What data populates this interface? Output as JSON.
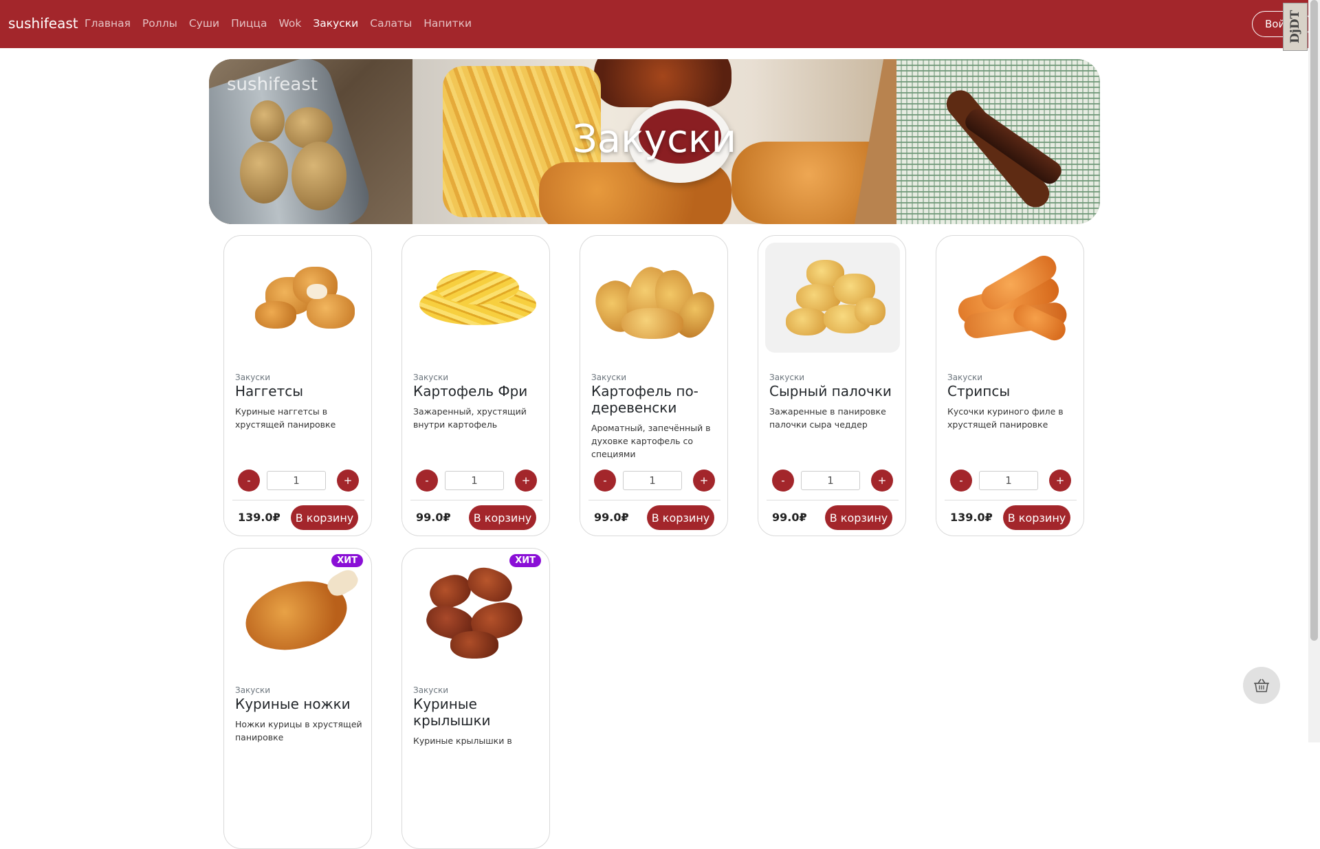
{
  "navbar": {
    "brand": "sushifeast",
    "items": [
      {
        "label": "Главная",
        "active": false
      },
      {
        "label": "Роллы",
        "active": false
      },
      {
        "label": "Суши",
        "active": false
      },
      {
        "label": "Пицца",
        "active": false
      },
      {
        "label": "Wok",
        "active": false
      },
      {
        "label": "Закуски",
        "active": true
      },
      {
        "label": "Салаты",
        "active": false
      },
      {
        "label": "Напитки",
        "active": false
      }
    ],
    "login_label": "Войти",
    "extension_badge": "DjDT"
  },
  "hero": {
    "logo": "sushifeast",
    "title": "Закуски"
  },
  "products": [
    {
      "category": "Закуски",
      "name": "Наггетсы",
      "description": "Куриные наггетсы в хрустящей панировке",
      "quantity": "1",
      "price": "139.0₽",
      "cart_label": "В корзину",
      "badge": "",
      "image": "nuggets"
    },
    {
      "category": "Закуски",
      "name": "Картофель Фри",
      "description": "Зажаренный, хрустящий внутри картофель",
      "quantity": "1",
      "price": "99.0₽",
      "cart_label": "В корзину",
      "badge": "",
      "image": "fries"
    },
    {
      "category": "Закуски",
      "name": "Картофель по-деревенски",
      "description": "Ароматный, запечённый в духовке картофель со специями",
      "quantity": "1",
      "price": "99.0₽",
      "cart_label": "В корзину",
      "badge": "",
      "image": "potato-wedges"
    },
    {
      "category": "Закуски",
      "name": "Сырный палочки",
      "description": "Зажаренные в панировке палочки сыра чеддер",
      "quantity": "1",
      "price": "99.0₽",
      "cart_label": "В корзину",
      "badge": "",
      "image": "cheese-sticks"
    },
    {
      "category": "Закуски",
      "name": "Стрипсы",
      "description": "Кусочки куриного филе в хрустящей панировке",
      "quantity": "1",
      "price": "139.0₽",
      "cart_label": "В корзину",
      "badge": "",
      "image": "strips"
    },
    {
      "category": "Закуски",
      "name": "Куриные ножки",
      "description": "Ножки курицы в хрустящей панировке",
      "badge": "ХИТ",
      "image": "chicken-legs"
    },
    {
      "category": "Закуски",
      "name": "Куриные крылышки",
      "description": "Куриные крылышки в",
      "badge": "ХИТ",
      "image": "chicken-wings"
    }
  ],
  "controls": {
    "minus": "-",
    "plus": "+"
  },
  "basket": {
    "icon": "basket-icon"
  },
  "colors": {
    "primary": "#a3262b",
    "badge": "#8a0fd6"
  }
}
